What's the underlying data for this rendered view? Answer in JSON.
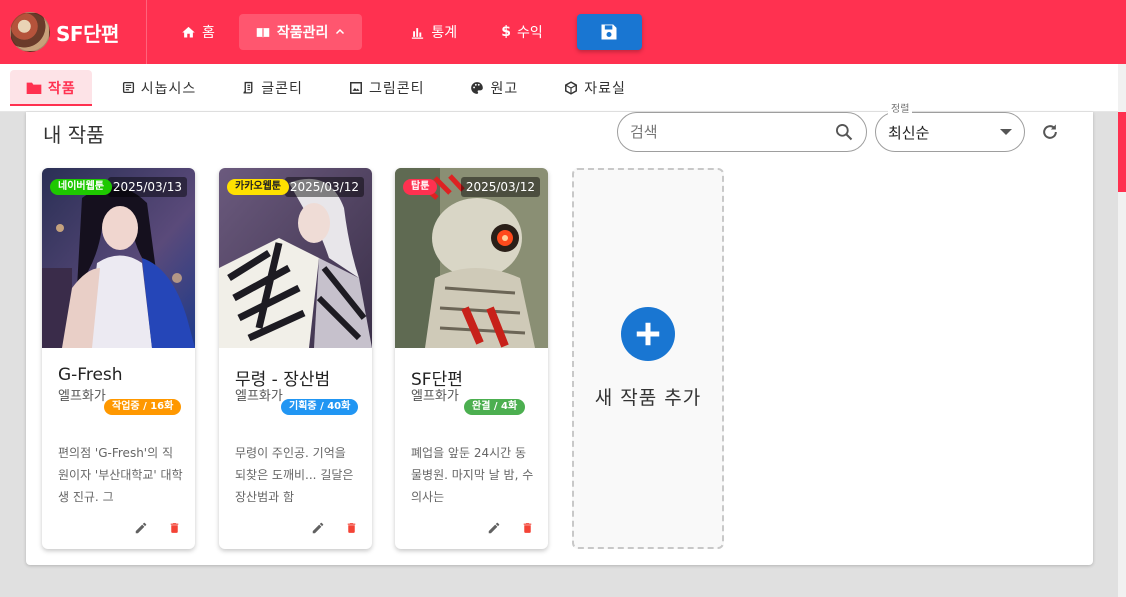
{
  "app": {
    "name": "SF단편"
  },
  "topnav": {
    "home": "홈",
    "works": "작품관리",
    "stats": "통계",
    "revenue": "수익"
  },
  "tabs": [
    {
      "label": "작품",
      "icon": "folder-icon",
      "active": true
    },
    {
      "label": "시놉시스",
      "icon": "document-icon",
      "active": false
    },
    {
      "label": "글콘티",
      "icon": "script-icon",
      "active": false
    },
    {
      "label": "그림콘티",
      "icon": "image-icon",
      "active": false
    },
    {
      "label": "원고",
      "icon": "palette-icon",
      "active": false
    },
    {
      "label": "자료실",
      "icon": "box-icon",
      "active": false
    }
  ],
  "main": {
    "title": "내 작품",
    "search_placeholder": "검색",
    "sort_legend": "정렬",
    "sort_value": "최신순"
  },
  "works": [
    {
      "platform": "네이버웹툰",
      "platform_color": "#1ec800",
      "platform_text_color": "#ffffff",
      "date": "2025/03/13",
      "title": "G-Fresh",
      "author": "엘프화가",
      "status": "작업중 / 16화",
      "status_color": "#ff9800",
      "description": "편의점 'G-Fresh'의 직원이자 '부산대학교' 대학생 진규. 그"
    },
    {
      "platform": "카카오웹툰",
      "platform_color": "#ffe000",
      "platform_text_color": "#222222",
      "date": "2025/03/12",
      "title": "무령 - 장산범",
      "author": "엘프화가",
      "status": "기획중 / 40화",
      "status_color": "#2196f3",
      "description": "무령이 주인공. 기억을 되찾은 도깨비... 길달은 장산범과 함"
    },
    {
      "platform": "탑툰",
      "platform_color": "#ff3150",
      "platform_text_color": "#ffffff",
      "date": "2025/03/12",
      "title": "SF단편",
      "author": "엘프화가",
      "status": "완결 / 4화",
      "status_color": "#4caf50",
      "description": "폐업을 앞둔 24시간 동물병원. 마지막 날 밤, 수의사는"
    }
  ],
  "add_work": {
    "label": "새 작품 추가"
  },
  "colors": {
    "brand": "#ff3150",
    "primary": "#1976d2"
  }
}
